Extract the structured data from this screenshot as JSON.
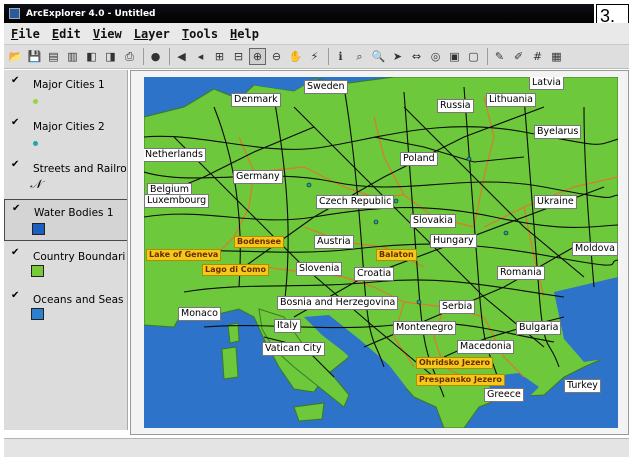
{
  "window": {
    "title": "ArcExplorer 4.0 - Untitled"
  },
  "figure_label": "3.",
  "menu": [
    {
      "key": "F",
      "rest": "ile"
    },
    {
      "key": "E",
      "rest": "dit"
    },
    {
      "key": "V",
      "rest": "iew"
    },
    {
      "key": "La",
      "rest": "yer"
    },
    {
      "key": "T",
      "rest": "ools"
    },
    {
      "key": "H",
      "rest": "elp"
    }
  ],
  "toolbar": {
    "buttons": [
      "open-icon",
      "save-icon",
      "add-layer-icon",
      "remove-layer-icon",
      "identify-layer-icon",
      "layer-properties-icon",
      "print-icon",
      "stop-icon",
      "back-icon",
      "zoom-previous-icon",
      "zoom-full-icon",
      "zoom-layer-icon",
      "zoom-in-icon",
      "zoom-out-icon",
      "pan-icon",
      "hotlink-icon",
      "info-icon",
      "find-icon",
      "search-icon",
      "locate-icon",
      "measure-icon",
      "buffer-icon",
      "select-icon",
      "clear-selection-icon",
      "edit-icon",
      "label-icon",
      "grid-icon",
      "table-icon"
    ],
    "active_index": 12
  },
  "layers": [
    {
      "name": "Major Cities 1",
      "checked": true,
      "symbol": "dot",
      "color": "#9bd43c"
    },
    {
      "name": "Major Cities 2",
      "checked": true,
      "symbol": "dot",
      "color": "#25a5a5"
    },
    {
      "name": "Streets and Railro",
      "checked": true,
      "symbol": "line",
      "color": "#000000"
    },
    {
      "name": "Water Bodies 1",
      "checked": true,
      "symbol": "box",
      "color": "#1d5fc0",
      "selected": true
    },
    {
      "name": "Country Boundari",
      "checked": true,
      "symbol": "box",
      "color": "#78c93a"
    },
    {
      "name": "Oceans and Seas",
      "checked": true,
      "symbol": "box",
      "color": "#2d7fd0"
    }
  ],
  "map": {
    "colors": {
      "ocean": "#2d73c9",
      "land": "#6ec83b",
      "roads": "#0a0a0a",
      "boundaries": "#d97b2a",
      "water_label_bg": "#f5c91b"
    },
    "countries": [
      "Latvia",
      "Sweden",
      "Denmark",
      "Russia",
      "Lithuania",
      "Byelarus",
      "Netherlands",
      "Poland",
      "Germany",
      "Belgium",
      "Luxembourg",
      "Czech Republic",
      "Ukraine",
      "Slovakia",
      "Austria",
      "Hungary",
      "Moldova",
      "Slovenia",
      "Croatia",
      "Romania",
      "Bosnia and Herzegovina",
      "Serbia",
      "Monaco",
      "Italy",
      "Montenegro",
      "Bulgaria",
      "Vatican City",
      "Macedonia",
      "Turkey",
      "Greece"
    ],
    "water_bodies": [
      "Bodensee",
      "Lake of Geneva",
      "Balaton",
      "Lago di Como",
      "Ohridsko Jezero",
      "Prespansko Jezero"
    ]
  },
  "status": ""
}
